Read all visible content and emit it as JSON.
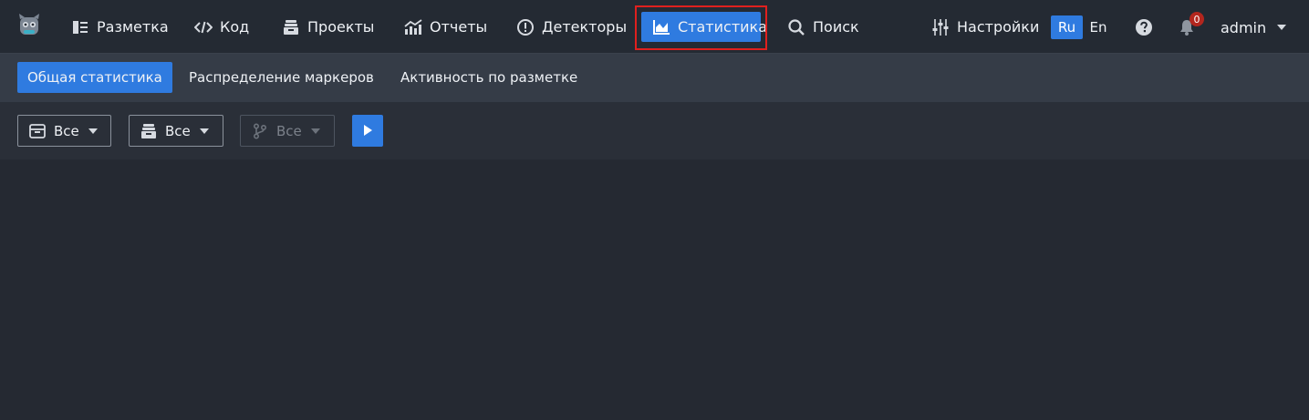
{
  "topnav": {
    "items": [
      {
        "label": "Разметка",
        "icon": "markup-icon"
      },
      {
        "label": "Код",
        "icon": "code-icon"
      },
      {
        "label": "Проекты",
        "icon": "projects-icon"
      },
      {
        "label": "Отчеты",
        "icon": "reports-icon"
      },
      {
        "label": "Детекторы",
        "icon": "detectors-icon"
      },
      {
        "label": "Статистика",
        "icon": "statistics-icon",
        "active": true
      },
      {
        "label": "Поиск",
        "icon": "search-icon"
      },
      {
        "label": "Настройки",
        "icon": "settings-sliders-icon"
      }
    ],
    "lang": {
      "ru": "Ru",
      "en": "En",
      "selected": "Ru"
    },
    "notifications_count": "0",
    "user": "admin"
  },
  "subtabs": [
    {
      "label": "Общая статистика",
      "active": true
    },
    {
      "label": "Распределение маркеров"
    },
    {
      "label": "Активность по разметке"
    }
  ],
  "filters": [
    {
      "label": "Все",
      "icon": "box-icon",
      "disabled": false
    },
    {
      "label": "Все",
      "icon": "archive-icon",
      "disabled": false
    },
    {
      "label": "Все",
      "icon": "branch-icon",
      "disabled": true
    }
  ],
  "colors": {
    "accent": "#2f7be0",
    "highlight_border": "#e0201e",
    "badge": "#b3261e",
    "background": "#252932"
  }
}
